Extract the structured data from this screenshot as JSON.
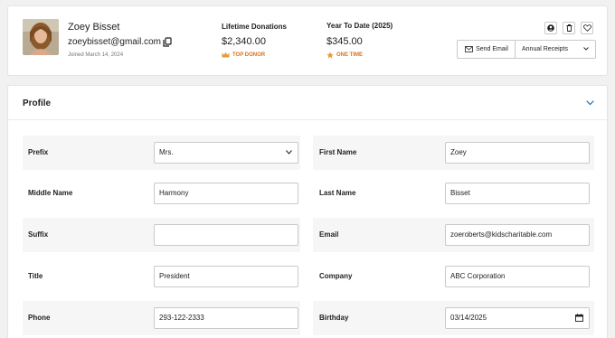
{
  "donor": {
    "name": "Zoey Bisset",
    "email": "zoeybisset@gmail.com",
    "joined": "Joined March 14, 2024"
  },
  "stats": {
    "lifetime": {
      "label": "Lifetime Donations",
      "value": "$2,340.00",
      "badge": "TOP DONOR",
      "badge_icon": "crown-icon"
    },
    "ytd": {
      "label": "Year To Date (2025)",
      "value": "$345.00",
      "badge": "ONE TIME",
      "badge_icon": "star-icon"
    }
  },
  "actions": {
    "send_email": "Send Email",
    "receipts": "Annual Receipts"
  },
  "profile": {
    "title": "Profile",
    "fields": {
      "prefix": {
        "label": "Prefix",
        "value": "Mrs."
      },
      "first_name": {
        "label": "First Name",
        "value": "Zoey"
      },
      "middle_name": {
        "label": "Middle Name",
        "value": "Harmony"
      },
      "last_name": {
        "label": "Last Name",
        "value": "Bisset"
      },
      "suffix": {
        "label": "Suffix",
        "value": ""
      },
      "email": {
        "label": "Email",
        "value": "zoeroberts@kidscharitable.com"
      },
      "title": {
        "label": "Title",
        "value": "President"
      },
      "company": {
        "label": "Company",
        "value": "ABC Corporation"
      },
      "phone": {
        "label": "Phone",
        "value": "293-122-2333"
      },
      "birthday": {
        "label": "Birthday",
        "value": "03/14/2025"
      }
    }
  },
  "colors": {
    "badge": "#d9731a",
    "accent": "#2271b1",
    "row_shade": "#f6f6f6"
  }
}
